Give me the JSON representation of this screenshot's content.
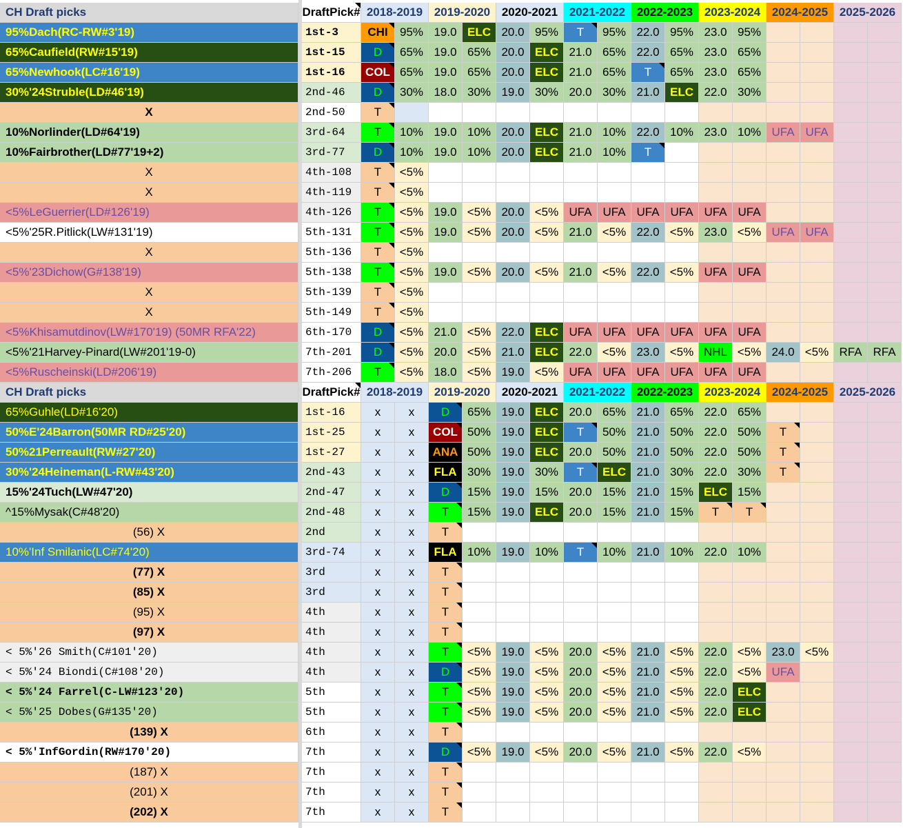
{
  "colors": {
    "header_bg": "#d9d9d9",
    "title_text": "#1f3b73",
    "col_2018": "#dbe7f5",
    "col_2019": "#fdf3cc",
    "col_2020": "#dbe7f5",
    "col_2021": "#00ffff",
    "col_2022": "#00ff00",
    "col_2023": "#ffff00",
    "col_2024": "#ff9900",
    "col_2025": "#e8d0dc",
    "green_light": "#b6d7a8",
    "green_dark": "#274e13",
    "blue_name": "#3d85c6",
    "peach": "#f9cb9c",
    "pink": "#ea9999",
    "teal": "#a2c4c9",
    "bright_green": "#00ff00",
    "d_blue": "#0b5394",
    "ufa_pink": "#ea9999"
  },
  "sections": [
    {
      "title": "CH Draft picks",
      "header": [
        "DraftPick#",
        "2018-2019",
        "2019-2020",
        "2020-2021",
        "2021-2022",
        "2022-2023",
        "2023-2024",
        "2024-2025",
        "2025-2026"
      ],
      "rows": [
        {
          "name": "95%Dach(RC-RW#3'19)",
          "pick": "1st-3",
          "cells": [
            "CHI",
            "95%",
            "19.0",
            "ELC",
            "20.0",
            "95%",
            "T",
            "95%",
            "22.0",
            "95%",
            "23.0",
            "95%",
            "",
            ""
          ]
        },
        {
          "name": "65%Caufield(RW#15'19)",
          "pick": "1st-15",
          "cells": [
            "D",
            "65%",
            "19.0",
            "65%",
            "20.0",
            "ELC",
            "21.0",
            "65%",
            "22.0",
            "65%",
            "23.0",
            "65%",
            "",
            ""
          ]
        },
        {
          "name": "65%Newhook(LC#16'19)",
          "pick": "1st-16",
          "cells": [
            "COL",
            "65%",
            "19.0",
            "65%",
            "20.0",
            "ELC",
            "21.0",
            "65%",
            "T",
            "65%",
            "23.0",
            "65%",
            "",
            ""
          ]
        },
        {
          "name": "30%'24Struble(LD#46'19)",
          "pick": "2nd-46",
          "cells": [
            "D",
            "30%",
            "18.0",
            "30%",
            "19.0",
            "30%",
            "20.0",
            "30%",
            "21.0",
            "ELC",
            "22.0",
            "30%",
            "",
            ""
          ]
        },
        {
          "name": "X",
          "pick": "2nd-50",
          "cells": [
            "T",
            "",
            "",
            "",
            "",
            "",
            "",
            "",
            "",
            "",
            "",
            "",
            "",
            ""
          ]
        },
        {
          "name": "10%Norlinder(LD#64'19)",
          "pick": "3rd-64",
          "cells": [
            "T",
            "10%",
            "19.0",
            "10%",
            "20.0",
            "ELC",
            "21.0",
            "10%",
            "22.0",
            "10%",
            "23.0",
            "10%",
            "UFA",
            "UFA"
          ]
        },
        {
          "name": "10%Fairbrother(LD#77'19+2)",
          "pick": "3rd-77",
          "cells": [
            "D",
            "10%",
            "19.0",
            "10%",
            "20.0",
            "ELC",
            "21.0",
            "10%",
            "T",
            "",
            "",
            "",
            "",
            ""
          ]
        },
        {
          "name": "X",
          "pick": "4th-108",
          "cells": [
            "T",
            "<5%",
            "",
            "",
            "",
            "",
            "",
            "",
            "",
            "",
            "",
            "",
            "",
            ""
          ]
        },
        {
          "name": "X",
          "pick": "4th-119",
          "cells": [
            "T",
            "<5%",
            "",
            "",
            "",
            "",
            "",
            "",
            "",
            "",
            "",
            "",
            "",
            ""
          ]
        },
        {
          "name": "<5%LeGuerrier(LD#126'19)",
          "pick": "4th-126",
          "cells": [
            "T",
            "<5%",
            "19.0",
            "<5%",
            "20.0",
            "<5%",
            "UFA",
            "UFA",
            "UFA",
            "UFA",
            "UFA",
            "UFA",
            "",
            ""
          ]
        },
        {
          "name": "<5%'25R.Pitlick(LW#131'19)",
          "pick": "5th-131",
          "cells": [
            "T",
            "<5%",
            "19.0",
            "<5%",
            "20.0",
            "<5%",
            "21.0",
            "<5%",
            "22.0",
            "<5%",
            "23.0",
            "<5%",
            "UFA",
            "UFA"
          ]
        },
        {
          "name": "X",
          "pick": "5th-136",
          "cells": [
            "T",
            "<5%",
            "",
            "",
            "",
            "",
            "",
            "",
            "",
            "",
            "",
            "",
            "",
            ""
          ]
        },
        {
          "name": "<5%'23Dichow(G#138'19)",
          "pick": "5th-138",
          "cells": [
            "T",
            "<5%",
            "19.0",
            "<5%",
            "20.0",
            "<5%",
            "21.0",
            "<5%",
            "22.0",
            "<5%",
            "UFA",
            "UFA",
            "",
            ""
          ]
        },
        {
          "name": "X",
          "pick": "5th-139",
          "cells": [
            "T",
            "<5%",
            "",
            "",
            "",
            "",
            "",
            "",
            "",
            "",
            "",
            "",
            "",
            ""
          ]
        },
        {
          "name": "X",
          "pick": "5th-149",
          "cells": [
            "T",
            "<5%",
            "",
            "",
            "",
            "",
            "",
            "",
            "",
            "",
            "",
            "",
            "",
            ""
          ]
        },
        {
          "name": "<5%Khisamutdinov(LW#170'19) (50MR RFA'22)",
          "pick": "6th-170",
          "cells": [
            "D",
            "<5%",
            "21.0",
            "<5%",
            "22.0",
            "ELC",
            "UFA",
            "UFA",
            "UFA",
            "UFA",
            "UFA",
            "UFA",
            "",
            ""
          ]
        },
        {
          "name": "<5%'21Harvey-Pinard(LW#201'19-0)",
          "pick": "7th-201",
          "cells": [
            "D",
            "<5%",
            "20.0",
            "<5%",
            "21.0",
            "ELC",
            "22.0",
            "<5%",
            "23.0",
            "<5%",
            "NHL",
            "<5%",
            "24.0",
            "<5%",
            "RFA",
            "RFA"
          ]
        },
        {
          "name": "<5%Ruscheinski(LD#206'19)",
          "pick": "7th-206",
          "cells": [
            "T",
            "<5%",
            "18.0",
            "<5%",
            "19.0",
            "<5%",
            "UFA",
            "UFA",
            "UFA",
            "UFA",
            "UFA",
            "UFA",
            "",
            ""
          ]
        }
      ]
    },
    {
      "title": "CH Draft picks",
      "header": [
        "DraftPick#",
        "2018-2019",
        "2019-2020",
        "2020-2021",
        "2021-2022",
        "2022-2023",
        "2023-2024",
        "2024-2025",
        "2025-2026"
      ],
      "rows": [
        {
          "name": "65%Guhle(LD#16'20)",
          "pick": "1st-16",
          "cells": [
            "x",
            "x",
            "D",
            "65%",
            "19.0",
            "ELC",
            "20.0",
            "65%",
            "21.0",
            "65%",
            "22.0",
            "65%",
            "",
            ""
          ]
        },
        {
          "name": "50%E'24Barron(50MR RD#25'20)",
          "pick": "1st-25",
          "cells": [
            "x",
            "x",
            "COL",
            "50%",
            "19.0",
            "ELC",
            "T",
            "50%",
            "21.0",
            "50%",
            "22.0",
            "50%",
            "T",
            ""
          ]
        },
        {
          "name": "50%21Perreault(RW#27'20)",
          "pick": "1st-27",
          "cells": [
            "x",
            "x",
            "ANA",
            "50%",
            "19.0",
            "ELC",
            "20.0",
            "50%",
            "21.0",
            "50%",
            "22.0",
            "50%",
            "T",
            ""
          ]
        },
        {
          "name": "30%'24Heineman(L-RW#43'20)",
          "pick": "2nd-43",
          "cells": [
            "x",
            "x",
            "FLA",
            "30%",
            "19.0",
            "30%",
            "T",
            "ELC",
            "21.0",
            "30%",
            "22.0",
            "30%",
            "T",
            ""
          ]
        },
        {
          "name": "15%'24Tuch(LW#47'20)",
          "pick": "2nd-47",
          "cells": [
            "x",
            "x",
            "D",
            "15%",
            "19.0",
            "15%",
            "20.0",
            "15%",
            "21.0",
            "15%",
            "ELC",
            "15%",
            "",
            ""
          ]
        },
        {
          "name": "^15%Mysak(C#48'20)",
          "pick": "2nd-48",
          "cells": [
            "x",
            "x",
            "T",
            "15%",
            "19.0",
            "ELC",
            "20.0",
            "15%",
            "21.0",
            "15%",
            "T",
            "T",
            "",
            ""
          ]
        },
        {
          "name": "(56) X",
          "pick": "2nd",
          "cells": [
            "x",
            "x",
            "T",
            "",
            "",
            "",
            "",
            "",
            "",
            "",
            "",
            "",
            "",
            ""
          ]
        },
        {
          "name": "10%'Inf Smilanic(LC#74'20)",
          "pick": "3rd-74",
          "cells": [
            "x",
            "x",
            "FLA",
            "10%",
            "19.0",
            "10%",
            "T",
            "10%",
            "21.0",
            "10%",
            "22.0",
            "10%",
            "",
            ""
          ]
        },
        {
          "name": "(77) X",
          "pick": "3rd",
          "cells": [
            "x",
            "x",
            "T",
            "",
            "",
            "",
            "",
            "",
            "",
            "",
            "",
            "",
            "",
            ""
          ]
        },
        {
          "name": "(85) X",
          "pick": "3rd",
          "cells": [
            "x",
            "x",
            "T",
            "",
            "",
            "",
            "",
            "",
            "",
            "",
            "",
            "",
            "",
            ""
          ]
        },
        {
          "name": "(95) X",
          "pick": "4th",
          "cells": [
            "x",
            "x",
            "T",
            "",
            "",
            "",
            "",
            "",
            "",
            "",
            "",
            "",
            "",
            ""
          ]
        },
        {
          "name": "(97) X",
          "pick": "4th",
          "cells": [
            "x",
            "x",
            "T",
            "",
            "",
            "",
            "",
            "",
            "",
            "",
            "",
            "",
            "",
            ""
          ]
        },
        {
          "name": "< 5%'26 Smith(C#101'20)",
          "pick": "4th",
          "cells": [
            "x",
            "x",
            "T",
            "<5%",
            "19.0",
            "<5%",
            "20.0",
            "<5%",
            "21.0",
            "<5%",
            "22.0",
            "<5%",
            "23.0",
            "<5%"
          ]
        },
        {
          "name": "< 5%'24 Biondi(C#108'20)",
          "pick": "4th",
          "cells": [
            "x",
            "x",
            "D",
            "<5%",
            "19.0",
            "<5%",
            "20.0",
            "<5%",
            "21.0",
            "<5%",
            "22.0",
            "<5%",
            "UFA",
            ""
          ]
        },
        {
          "name": "< 5%'24 Farrel(C-LW#123'20)",
          "pick": "5th",
          "cells": [
            "x",
            "x",
            "T",
            "<5%",
            "19.0",
            "<5%",
            "20.0",
            "<5%",
            "21.0",
            "<5%",
            "22.0",
            "ELC",
            "",
            ""
          ]
        },
        {
          "name": "< 5%'25 Dobes(G#135'20)",
          "pick": "5th",
          "cells": [
            "x",
            "x",
            "T",
            "<5%",
            "19.0",
            "<5%",
            "20.0",
            "<5%",
            "21.0",
            "<5%",
            "22.0",
            "ELC",
            "",
            ""
          ]
        },
        {
          "name": "(139) X",
          "pick": "6th",
          "cells": [
            "x",
            "x",
            "T",
            "",
            "",
            "",
            "",
            "",
            "",
            "",
            "",
            "",
            "",
            ""
          ]
        },
        {
          "name": "< 5%'InfGordin(RW#170'20)",
          "pick": "7th",
          "cells": [
            "x",
            "x",
            "D",
            "<5%",
            "19.0",
            "<5%",
            "20.0",
            "<5%",
            "21.0",
            "<5%",
            "22.0",
            "<5%",
            "",
            ""
          ]
        },
        {
          "name": "(187) X",
          "pick": "7th",
          "cells": [
            "x",
            "x",
            "T",
            "",
            "",
            "",
            "",
            "",
            "",
            "",
            "",
            "",
            "",
            ""
          ]
        },
        {
          "name": "(201) X",
          "pick": "7th",
          "cells": [
            "x",
            "x",
            "T",
            "",
            "",
            "",
            "",
            "",
            "",
            "",
            "",
            "",
            "",
            ""
          ]
        },
        {
          "name": "(202) X",
          "pick": "7th",
          "cells": [
            "x",
            "x",
            "T",
            "",
            "",
            "",
            "",
            "",
            "",
            "",
            "",
            "",
            "",
            ""
          ]
        }
      ]
    }
  ]
}
